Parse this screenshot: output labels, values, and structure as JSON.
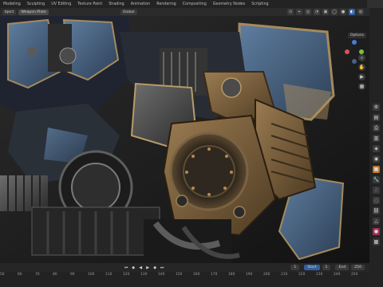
{
  "topbar": {
    "tabs": [
      "Modeling",
      "Sculpting",
      "UV Editing",
      "Texture Paint",
      "Shading",
      "Animation",
      "Rendering",
      "Compositing",
      "Geometry Nodes",
      "Scripting"
    ],
    "scene": "Scene"
  },
  "header": {
    "object_label": "bject",
    "mode": "Weapon.Plate",
    "orientation": "Global"
  },
  "viewport": {
    "options_label": "Options"
  },
  "timeline": {
    "frame_current": "1",
    "start_label": "Start",
    "start_value": "1",
    "end_label": "End",
    "end_value": "250"
  },
  "ruler": {
    "ticks": [
      "50",
      "60",
      "70",
      "80",
      "90",
      "100",
      "110",
      "120",
      "130",
      "140",
      "150",
      "160",
      "170",
      "180",
      "190",
      "200",
      "210",
      "220",
      "230",
      "240",
      "250"
    ]
  },
  "colors": {
    "accent": "#345f9e",
    "axis_x": "#d9534f",
    "axis_y": "#7fbf3f",
    "axis_z": "#3f7fd9"
  }
}
